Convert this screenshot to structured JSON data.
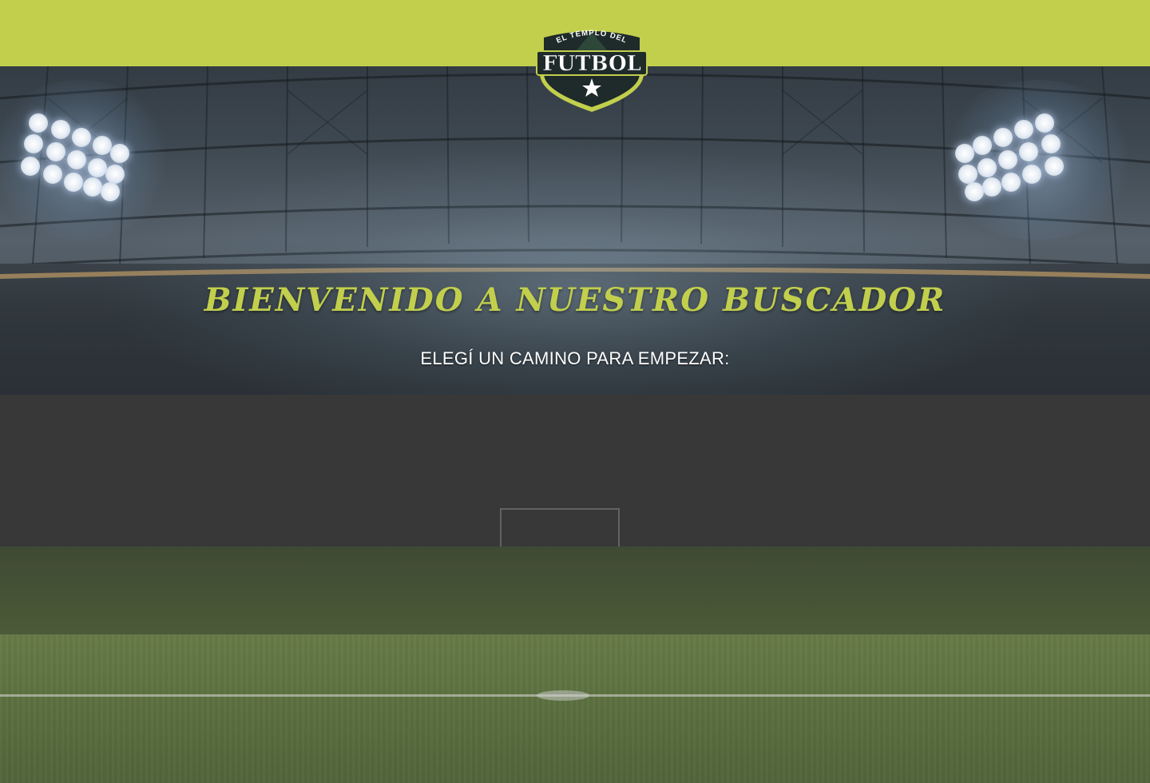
{
  "header": {
    "logo": {
      "icon": "el-templo-del-futbol-shield-logo",
      "top_text": "EL TEMPLO DEL",
      "main_text": "FUTBOL"
    },
    "bar_color": "#c2cf4d"
  },
  "hero": {
    "title": "BIENVENIDO A NUESTRO BUSCADOR",
    "subtitle": "ELEGÍ UN CAMINO PARA EMPEZAR:",
    "accent_color": "#c2cf4d",
    "background": "stadium-at-night-image"
  }
}
